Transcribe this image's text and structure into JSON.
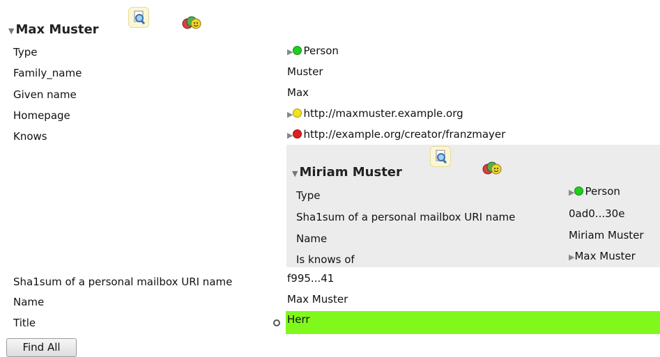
{
  "main": {
    "title": "Max Muster",
    "inspect_icon": "inspect-magnifier-icon",
    "faces_icon": "colored-faces-icon",
    "rows": [
      {
        "label": "Type",
        "value": "Person",
        "dot": "#22cc22",
        "arrow": true
      },
      {
        "label": "Family_name",
        "value": "Muster"
      },
      {
        "label": "Given name",
        "value": "Max"
      },
      {
        "label": "Homepage",
        "value": "http://maxmuster.example.org",
        "dot": "#f2e21a",
        "arrow": true
      },
      {
        "label": "Knows",
        "value": "http://example.org/creator/franzmayer",
        "dot": "#e02020",
        "arrow": true
      },
      {
        "label": "Sha1sum of a personal mailbox URI name",
        "value": "f995...41"
      },
      {
        "label": "Name",
        "value": "Max Muster"
      },
      {
        "label": "Title",
        "value": "Herr",
        "highlight_color": "#80f81c"
      }
    ]
  },
  "nested": {
    "title": "Miriam Muster",
    "rows": [
      {
        "label": "Type",
        "value": "Person",
        "dot": "#22cc22",
        "arrow": true
      },
      {
        "label": "Sha1sum of a personal mailbox URI name",
        "value": "0ad0...30e"
      },
      {
        "label": "Name",
        "value": "Miriam Muster"
      },
      {
        "label": "Is knows of",
        "value": "Max Muster",
        "arrow": true
      }
    ]
  },
  "find_all_label": "Find All"
}
